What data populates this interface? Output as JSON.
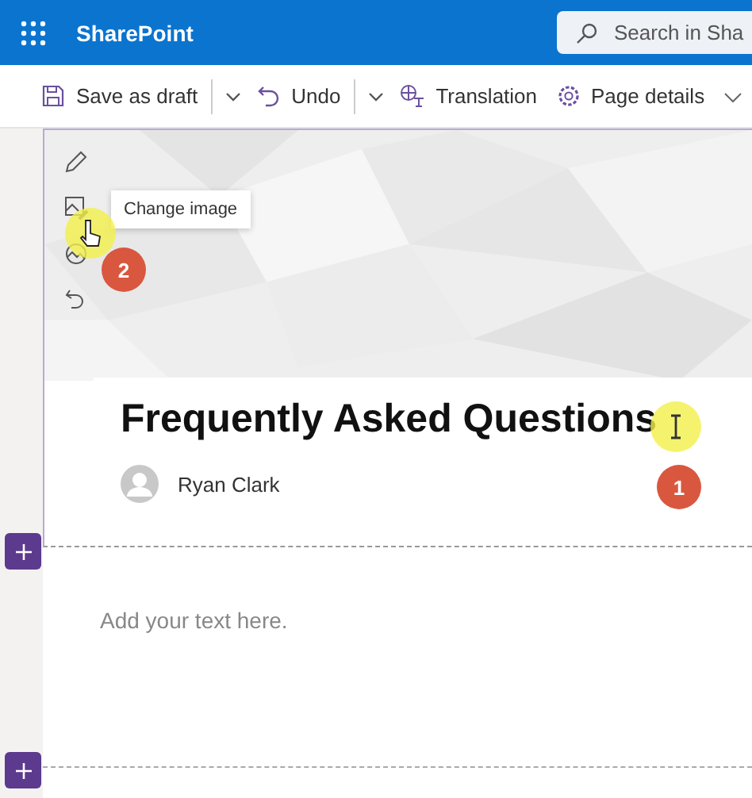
{
  "app": {
    "name": "SharePoint"
  },
  "search": {
    "placeholder": "Search in Sha"
  },
  "toolbar": [
    {
      "label": "Save as draft",
      "kind": "save",
      "split": true
    },
    {
      "label": "Undo",
      "kind": "undo",
      "split": true
    },
    {
      "label": "Translation",
      "kind": "translate",
      "split": false
    },
    {
      "label": "Page details",
      "kind": "gear",
      "split": false
    }
  ],
  "tooltip": "Change image",
  "title": "Frequently Asked Questions",
  "author": "Ryan Clark",
  "text_placeholder": "Add your text here.",
  "step_markers": [
    "1",
    "2"
  ]
}
